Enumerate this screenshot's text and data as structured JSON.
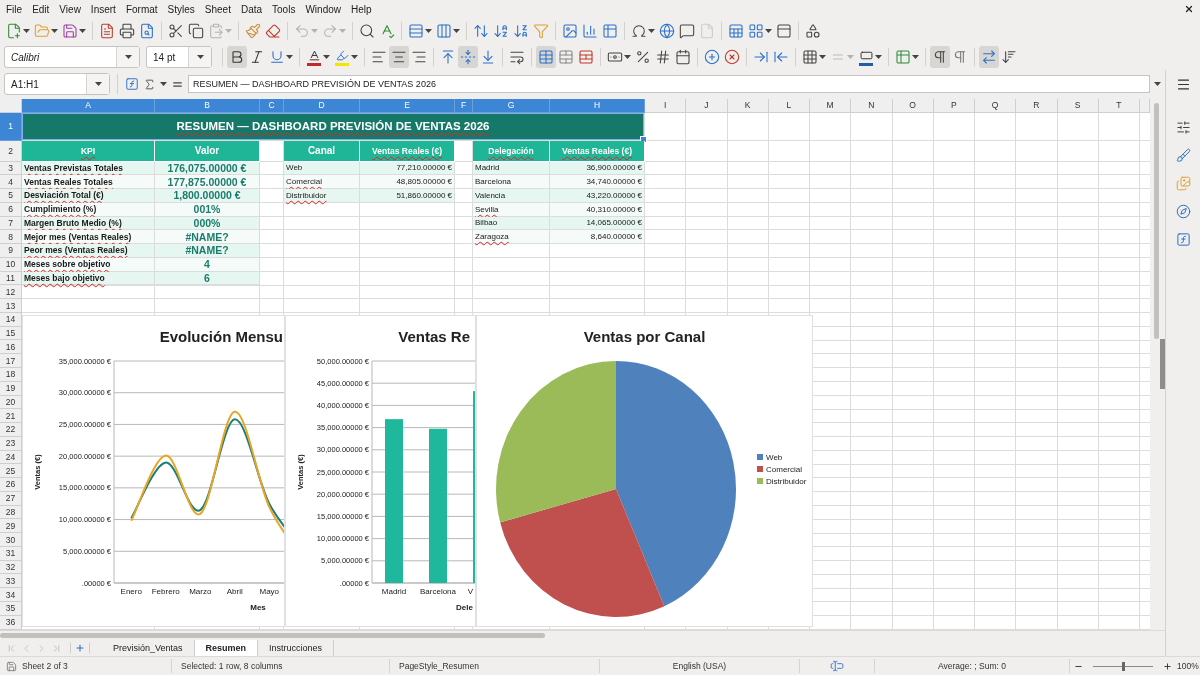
{
  "menu_bar": [
    "File",
    "Edit",
    "View",
    "Insert",
    "Format",
    "Styles",
    "Sheet",
    "Data",
    "Tools",
    "Window",
    "Help"
  ],
  "standard_toolbar": [
    {
      "disabled": false
    },
    {
      "disabled": false
    },
    {
      "disabled": false
    },
    {
      "disabled": false
    },
    {
      "disabled": false
    },
    {
      "disabled": false
    },
    {
      "disabled": false
    },
    {
      "disabled": false
    },
    {
      "disabled": true
    },
    {
      "disabled": false
    },
    {
      "disabled": false
    },
    {
      "disabled": true
    },
    {
      "disabled": true
    },
    {
      "disabled": false
    },
    {
      "disabled": false
    },
    {
      "disabled": false
    },
    {
      "disabled": false
    },
    {
      "disabled": false
    },
    {
      "disabled": false
    },
    {
      "disabled": false
    },
    {
      "disabled": false
    },
    {
      "disabled": false
    },
    {
      "disabled": false
    },
    {
      "disabled": false
    },
    {
      "disabled": false
    },
    {
      "disabled": false
    },
    {
      "disabled": false
    },
    {
      "disabled": true
    },
    {
      "disabled": false
    },
    {
      "disabled": false
    },
    {
      "disabled": false
    },
    {
      "disabled": false
    }
  ],
  "formatting_toolbar": {
    "font_name": "Calibri",
    "font_size": "14 pt",
    "buttons": [
      {
        "pressed": true,
        "disabled": false
      },
      {
        "pressed": false,
        "disabled": false
      },
      {
        "pressed": false,
        "disabled": false
      },
      {
        "pressed": false,
        "disabled": false
      },
      {
        "pressed": false,
        "disabled": false
      },
      {
        "pressed": false,
        "disabled": false
      },
      {
        "pressed": true,
        "disabled": false
      },
      {
        "pressed": false,
        "disabled": false
      },
      {
        "pressed": false,
        "disabled": false
      },
      {
        "pressed": true,
        "disabled": false
      },
      {
        "pressed": false,
        "disabled": false
      },
      {
        "pressed": false,
        "disabled": false
      },
      {
        "pressed": true,
        "disabled": false
      },
      {
        "pressed": false,
        "disabled": false
      },
      {
        "pressed": false,
        "disabled": false
      },
      {
        "pressed": false,
        "disabled": false
      },
      {
        "pressed": false,
        "disabled": false
      },
      {
        "pressed": false,
        "disabled": false
      },
      {
        "pressed": false,
        "disabled": false
      },
      {
        "pressed": false,
        "disabled": false
      },
      {
        "pressed": false,
        "disabled": false
      },
      {
        "pressed": false,
        "disabled": false
      },
      {
        "pressed": false,
        "disabled": false
      },
      {
        "pressed": false,
        "disabled": false
      },
      {
        "pressed": false,
        "disabled": true
      },
      {
        "pressed": false,
        "disabled": false
      },
      {
        "pressed": false,
        "disabled": false
      },
      {
        "pressed": true,
        "disabled": false
      },
      {
        "pressed": false,
        "disabled": false
      },
      {
        "pressed": true,
        "disabled": false
      },
      {
        "pressed": false,
        "disabled": false
      }
    ]
  },
  "formula_bar": {
    "name_box": "A1:H1",
    "formula": "RESUMEN — DASHBOARD PREVISIÓN DE VENTAS 2026"
  },
  "sheet": {
    "columns": [
      {
        "label": "A",
        "selected": true
      },
      {
        "label": "B",
        "selected": true
      },
      {
        "label": "C",
        "selected": true
      },
      {
        "label": "D",
        "selected": true
      },
      {
        "label": "E",
        "selected": true
      },
      {
        "label": "F",
        "selected": true
      },
      {
        "label": "G",
        "selected": true
      },
      {
        "label": "H",
        "selected": true
      },
      {
        "label": "I",
        "selected": false
      },
      {
        "label": "J",
        "selected": false
      },
      {
        "label": "K",
        "selected": false
      },
      {
        "label": "L",
        "selected": false
      },
      {
        "label": "M",
        "selected": false
      },
      {
        "label": "N",
        "selected": false
      },
      {
        "label": "O",
        "selected": false
      },
      {
        "label": "P",
        "selected": false
      },
      {
        "label": "Q",
        "selected": false
      },
      {
        "label": "R",
        "selected": false
      },
      {
        "label": "S",
        "selected": false
      },
      {
        "label": "T",
        "selected": false
      }
    ],
    "rows": [
      {
        "label": "1",
        "selected": true
      },
      {
        "label": "2",
        "selected": false
      },
      {
        "label": "3",
        "selected": false
      },
      {
        "label": "4",
        "selected": false
      },
      {
        "label": "5",
        "selected": false
      },
      {
        "label": "6",
        "selected": false
      },
      {
        "label": "7",
        "selected": false
      },
      {
        "label": "8",
        "selected": false
      },
      {
        "label": "9",
        "selected": false
      },
      {
        "label": "10",
        "selected": false
      },
      {
        "label": "11",
        "selected": false
      },
      {
        "label": "12",
        "selected": false
      },
      {
        "label": "13",
        "selected": false
      },
      {
        "label": "14",
        "selected": false
      },
      {
        "label": "15",
        "selected": false
      },
      {
        "label": "16",
        "selected": false
      },
      {
        "label": "17",
        "selected": false
      },
      {
        "label": "18",
        "selected": false
      },
      {
        "label": "19",
        "selected": false
      },
      {
        "label": "20",
        "selected": false
      },
      {
        "label": "21",
        "selected": false
      },
      {
        "label": "22",
        "selected": false
      },
      {
        "label": "23",
        "selected": false
      },
      {
        "label": "24",
        "selected": false
      },
      {
        "label": "25",
        "selected": false
      },
      {
        "label": "26",
        "selected": false
      },
      {
        "label": "27",
        "selected": false
      },
      {
        "label": "28",
        "selected": false
      },
      {
        "label": "29",
        "selected": false
      },
      {
        "label": "30",
        "selected": false
      },
      {
        "label": "31",
        "selected": false
      },
      {
        "label": "32",
        "selected": false
      },
      {
        "label": "33",
        "selected": false
      },
      {
        "label": "34",
        "selected": false
      },
      {
        "label": "35",
        "selected": false
      },
      {
        "label": "36",
        "selected": false
      }
    ],
    "title": {
      "text": "RESUMEN — DASHBOARD PREVISIÓN DE VENTAS 2026",
      "misspelled": true,
      "selected": true
    },
    "kpi_table": {
      "headers": [
        {
          "text": "KPI",
          "misspelled": true
        },
        {
          "text": "Valor",
          "misspelled": false
        }
      ],
      "rows": [
        {
          "label": {
            "text": "Ventas Previstas Totales",
            "misspelled": true
          },
          "value": "176,075.00000 €"
        },
        {
          "label": {
            "text": "Ventas Reales Totales",
            "misspelled": true
          },
          "value": "177,875.00000 €"
        },
        {
          "label": {
            "text": "Desviación Total (€)",
            "misspelled": true
          },
          "value": "1,800.00000 €"
        },
        {
          "label": {
            "text": "Cumplimiento (%)",
            "misspelled": true
          },
          "value": "001%"
        },
        {
          "label": {
            "text": "Margen Bruto Medio (%)",
            "misspelled": true
          },
          "value": "000%"
        },
        {
          "label": {
            "text": "Mejor mes (Ventas Reales)",
            "misspelled": true
          },
          "value": "#NAME?"
        },
        {
          "label": {
            "text": "Peor mes (Ventas Reales)",
            "misspelled": true
          },
          "value": "#NAME?"
        },
        {
          "label": {
            "text": "Meses sobre objetivo",
            "misspelled": true
          },
          "value": "4"
        },
        {
          "label": {
            "text": "Meses bajo objetivo",
            "misspelled": true
          },
          "value": "6"
        }
      ]
    },
    "channel_table": {
      "headers": [
        {
          "text": "Canal",
          "misspelled": false
        },
        {
          "text": "Ventas Reales (€)",
          "misspelled": true
        }
      ],
      "rows": [
        {
          "name": {
            "text": "Web",
            "misspelled": false
          },
          "amount": "77,210.00000 €"
        },
        {
          "name": {
            "text": "Comercial",
            "misspelled": true
          },
          "amount": "48,805.00000 €"
        },
        {
          "name": {
            "text": "Distribuidor",
            "misspelled": true
          },
          "amount": "51,860.00000 €"
        }
      ]
    },
    "office_table": {
      "headers": [
        {
          "text": "Delegación",
          "misspelled": true
        },
        {
          "text": "Ventas Reales (€)",
          "misspelled": true
        }
      ],
      "rows": [
        {
          "name": {
            "text": "Madrid",
            "misspelled": false
          },
          "amount": "36,900.00000 €"
        },
        {
          "name": {
            "text": "Barcelona",
            "misspelled": false
          },
          "amount": "34,740.00000 €"
        },
        {
          "name": {
            "text": "Valencia",
            "misspelled": false
          },
          "amount": "43,220.00000 €"
        },
        {
          "name": {
            "text": "Sevilla",
            "misspelled": true
          },
          "amount": "40,310.00000 €"
        },
        {
          "name": {
            "text": "Bilbao",
            "misspelled": false
          },
          "amount": "14,065.00000 €"
        },
        {
          "name": {
            "text": "Zaragoza",
            "misspelled": true
          },
          "amount": "8,640.00000 €"
        }
      ]
    }
  },
  "charts": [
    {
      "chart_data": {
        "type": "line",
        "title": "Evolución Mensu",
        "xlabel": "Mes",
        "ylabel": "Ventas (€)",
        "categories": [
          "Enero",
          "Febrero",
          "Marzo",
          "Abril",
          "Mayo"
        ],
        "series": [
          {
            "color": "#1b7f70",
            "values": [
              10200,
              19000,
              11500,
              25800,
              12500
            ]
          },
          {
            "color": "#e8a52a",
            "values": [
              9800,
              20100,
              10900,
              27000,
              12000
            ]
          }
        ],
        "ylim": [
          0,
          35000
        ],
        "grid": true,
        "yticks": [
          {
            "value": 0,
            "label": ".00000 €"
          },
          {
            "value": 5000,
            "label": "5,000.00000 €"
          },
          {
            "value": 10000,
            "label": "10,000.00000 €"
          },
          {
            "value": 15000,
            "label": "15,000.00000 €"
          },
          {
            "value": 20000,
            "label": "20,000.00000 €"
          },
          {
            "value": 25000,
            "label": "25,000.00000 €"
          },
          {
            "value": 30000,
            "label": "30,000.00000 €"
          },
          {
            "value": 35000,
            "label": "35,000.00000 €"
          }
        ]
      }
    },
    {
      "chart_data": {
        "type": "bar",
        "title": "Ventas Re",
        "xlabel": "Dele",
        "ylabel": "Ventas (€)",
        "categories": [
          "Madrid",
          "Barcelona",
          "V"
        ],
        "series": [
          {
            "color": "#1fb89d",
            "values": [
              36900,
              34740,
              43220
            ]
          }
        ],
        "ylim": [
          0,
          50000
        ],
        "grid": true,
        "yticks": [
          {
            "value": 0,
            "label": ".00000 €"
          },
          {
            "value": 5000,
            "label": "5,000.00000 €"
          },
          {
            "value": 10000,
            "label": "10,000.00000 €"
          },
          {
            "value": 15000,
            "label": "15,000.00000 €"
          },
          {
            "value": 20000,
            "label": "20,000.00000 €"
          },
          {
            "value": 25000,
            "label": "25,000.00000 €"
          },
          {
            "value": 30000,
            "label": "30,000.00000 €"
          },
          {
            "value": 35000,
            "label": "35,000.00000 €"
          },
          {
            "value": 40000,
            "label": "40,000.00000 €"
          },
          {
            "value": 45000,
            "label": "45,000.00000 €"
          },
          {
            "value": 50000,
            "label": "50,000.00000 €"
          }
        ]
      }
    },
    {
      "chart_data": {
        "type": "pie",
        "title": "Ventas por Canal",
        "categories": [
          "Web",
          "Comercial",
          "Distribuidor"
        ],
        "series": [
          {
            "colors": [
              "#4f81bd",
              "#c0504d",
              "#9bbb59"
            ],
            "values": [
              43.4,
              27.4,
              29.2
            ]
          }
        ],
        "legend": "right"
      }
    }
  ],
  "sheet_tabs": {
    "navigation": [
      {
        "disabled": true
      },
      {
        "disabled": true
      },
      {
        "disabled": true
      },
      {
        "disabled": true
      }
    ],
    "tabs": [
      {
        "label": "Previsión_Ventas",
        "selected": false
      },
      {
        "label": "Resumen",
        "selected": true
      },
      {
        "label": "Instrucciones",
        "selected": false
      }
    ]
  },
  "status_bar": {
    "sheet": "Sheet 2 of 3",
    "selection": "Selected: 1 row, 8 columns",
    "page_style": "PageStyle_Resumen",
    "language": "English (USA)",
    "summary": "Average: ; Sum: 0",
    "zoom": {
      "level": 0.5,
      "reading": "100%"
    }
  }
}
